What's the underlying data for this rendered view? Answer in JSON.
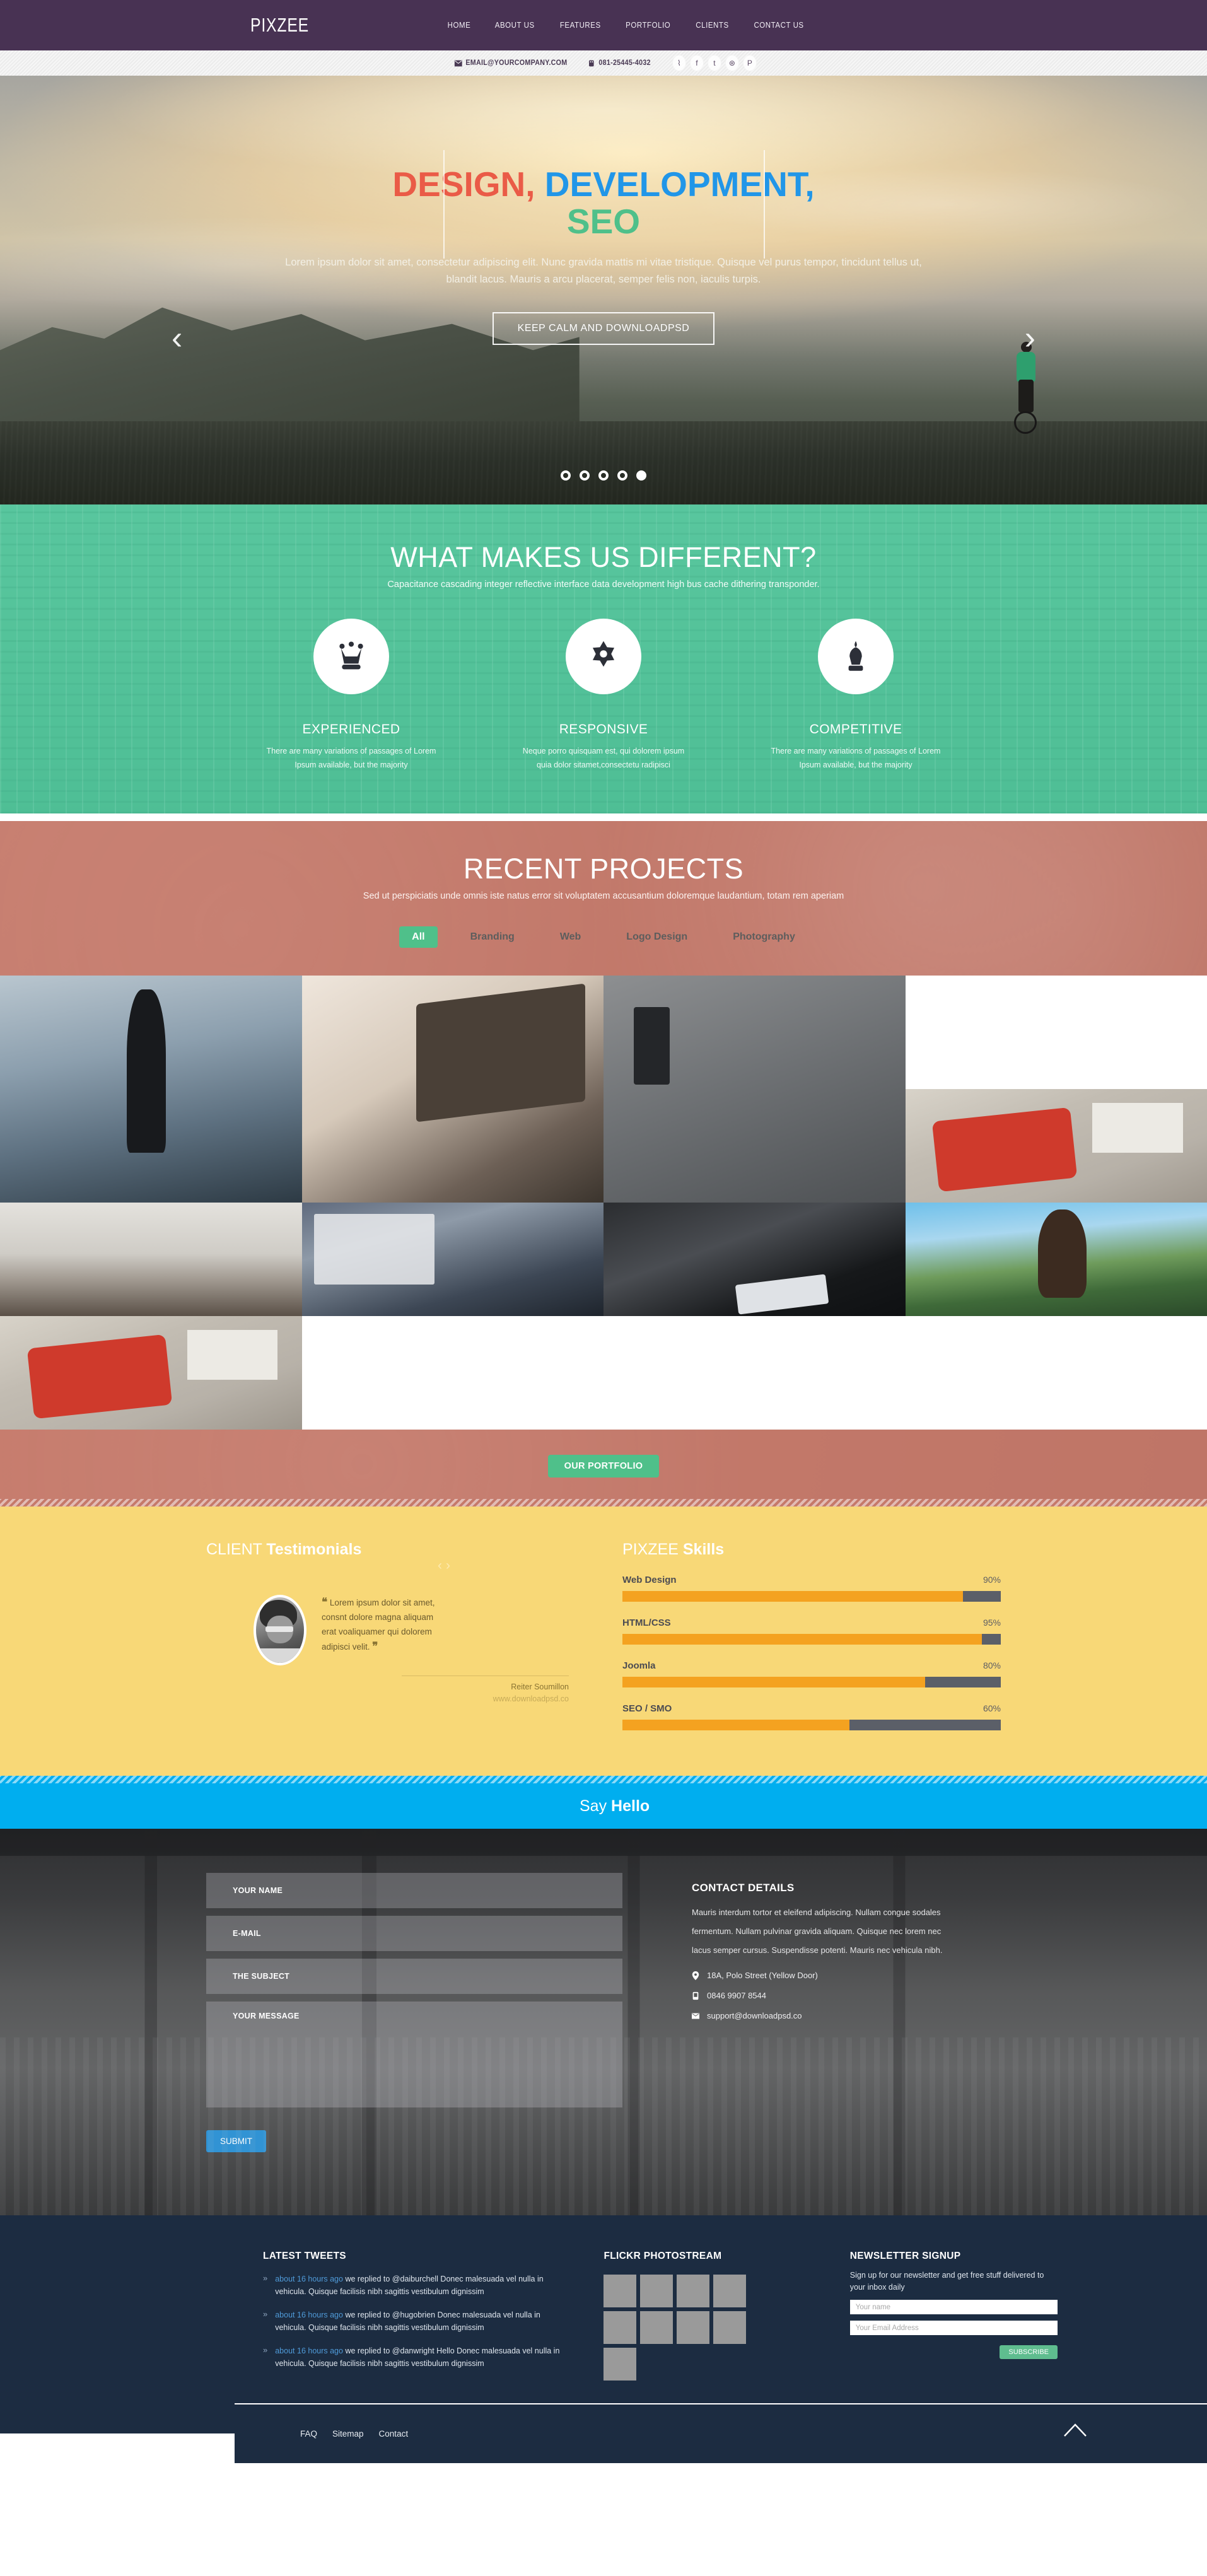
{
  "header": {
    "logo": "PIXZEE",
    "menu": [
      "HOME",
      "ABOUT US",
      "FEATURES",
      "PORTFOLIO",
      "CLIENTS",
      "CONTACT US"
    ],
    "email": "EMAIL@YOURCOMPANY.COM",
    "phone": "081-25445-4032",
    "social": [
      {
        "name": "rss-icon",
        "glyph": "⌇"
      },
      {
        "name": "facebook-icon",
        "glyph": "f"
      },
      {
        "name": "twitter-icon",
        "glyph": "t"
      },
      {
        "name": "dribbble-icon",
        "glyph": "⊛"
      },
      {
        "name": "pinterest-icon",
        "glyph": "P"
      }
    ]
  },
  "hero": {
    "title_1": "DESIGN,",
    "title_2": "DEVELOPMENT,",
    "title_3": "SEO",
    "paragraph": "Lorem ipsum dolor sit amet, consectetur adipiscing elit. Nunc gravida mattis mi vitae tristique. Quisque vel purus tempor, tincidunt tellus ut, blandit lacus. Mauris a arcu placerat, semper felis non, iaculis turpis.",
    "button": "KEEP CALM AND DOWNLOADPSD",
    "prev": "‹",
    "next": "›",
    "dots": 5,
    "active_dot": 5,
    "colors": {
      "design": "#ea5b47",
      "development": "#2196e8",
      "seo": "#4fc08a"
    }
  },
  "different": {
    "title": "WHAT MAKES US DIFFERENT?",
    "subtitle": "Capacitance cascading integer reflective interface data development high bus cache dithering transponder.",
    "bg_color": "#52c49a",
    "features": [
      {
        "icon": "crown-icon",
        "title": "EXPERIENCED",
        "text": "There are many variations of passages of Lorem Ipsum available, but the majority"
      },
      {
        "icon": "badge-star-icon",
        "title": "RESPONSIVE",
        "text": "Neque porro quisquam est, qui dolorem ipsum quia dolor sitamet,consectetu radipisci"
      },
      {
        "icon": "chess-king-icon",
        "title": "COMPETITIVE",
        "text": "There are many variations of passages of Lorem Ipsum available, but the majority"
      }
    ]
  },
  "projects": {
    "title": "RECENT PROJECTS",
    "subtitle": "Sed ut perspiciatis unde omnis iste natus error sit voluptatem accusantium doloremque laudantium, totam rem aperiam",
    "bg_color": "#c5796a",
    "filters": [
      "All",
      "Branding",
      "Web",
      "Logo Design",
      "Photography"
    ],
    "active_filter": "All",
    "portfolio_button": "OUR PORTFOLIO",
    "accent_color": "#4fc08a"
  },
  "testimonials": {
    "title_light": "CLIENT",
    "title_bold": "Testimonials",
    "prev": "‹",
    "next": "›",
    "quote": "Lorem ipsum dolor sit amet, consnt dolore magna aliquam erat voaliquamer qui dolorem adipisci velit.",
    "author": "Reiter Soumillon",
    "author_url": "www.downloadpsd.co",
    "bg_color": "#f8d877"
  },
  "skills": {
    "title_light": "PIXZEE",
    "title_bold": "Skills",
    "bar_color": "#f4a220",
    "track_color": "#5b5f68",
    "items": [
      {
        "label": "Web Design",
        "percent": "90%",
        "value": 90
      },
      {
        "label": "HTML/CSS",
        "percent": "95%",
        "value": 95
      },
      {
        "label": "Joomla",
        "percent": "80%",
        "value": 80
      },
      {
        "label": "SEO / SMO",
        "percent": "60%",
        "value": 60
      }
    ]
  },
  "hello": {
    "light": "Say",
    "bold": "Hello",
    "bg_color": "#00aeef"
  },
  "contact": {
    "fields": [
      {
        "name": "your-name-field",
        "label": "YOUR NAME"
      },
      {
        "name": "email-field",
        "label": "E-MAIL"
      },
      {
        "name": "subject-field",
        "label": "THE SUBJECT"
      },
      {
        "name": "message-field",
        "label": "YOUR MESSAGE"
      }
    ],
    "submit": "SUBMIT",
    "details_title": "CONTACT DETAILS",
    "details_text": "Mauris interdum tortor et eleifend adipiscing. Nullam congue sodales fermentum. Nullam pulvinar gravida aliquam. Quisque nec lorem nec lacus semper cursus. Suspendisse potenti. Mauris nec vehicula nibh.",
    "address": "18A, Polo Street (Yellow Door)",
    "phone": "0846 9907 8544",
    "email": "support@downloadpsd.co"
  },
  "footer": {
    "tweets_title": "LATEST TWEETS",
    "tweets": [
      {
        "time": "about 16 hours ago",
        "text": "we replied to @daiburchell Donec malesuada vel nulla in vehicula. Quisque facilisis nibh sagittis vestibulum dignissim"
      },
      {
        "time": "about 16 hours ago",
        "text": "we replied to @hugobrien Donec malesuada vel nulla in vehicula. Quisque facilisis nibh sagittis vestibulum dignissim"
      },
      {
        "time": "about 16 hours ago",
        "text": "we replied to @danwright Hello Donec malesuada vel nulla in vehicula. Quisque facilisis nibh sagittis vestibulum dignissim"
      }
    ],
    "flickr_title": "FLICKR PHOTOSTREAM",
    "flickr_count": 9,
    "newsletter_title": "NEWSLETTER SIGNUP",
    "newsletter_text": "Sign up for our newsletter and get free stuff delivered to your inbox daily",
    "name_placeholder": "Your name",
    "email_placeholder": "Your Email Address",
    "subscribe": "SUBSCRIBE",
    "bottom_links": [
      "FAQ",
      "Sitemap",
      "Contact"
    ],
    "bg_color": "#1c2c41"
  }
}
